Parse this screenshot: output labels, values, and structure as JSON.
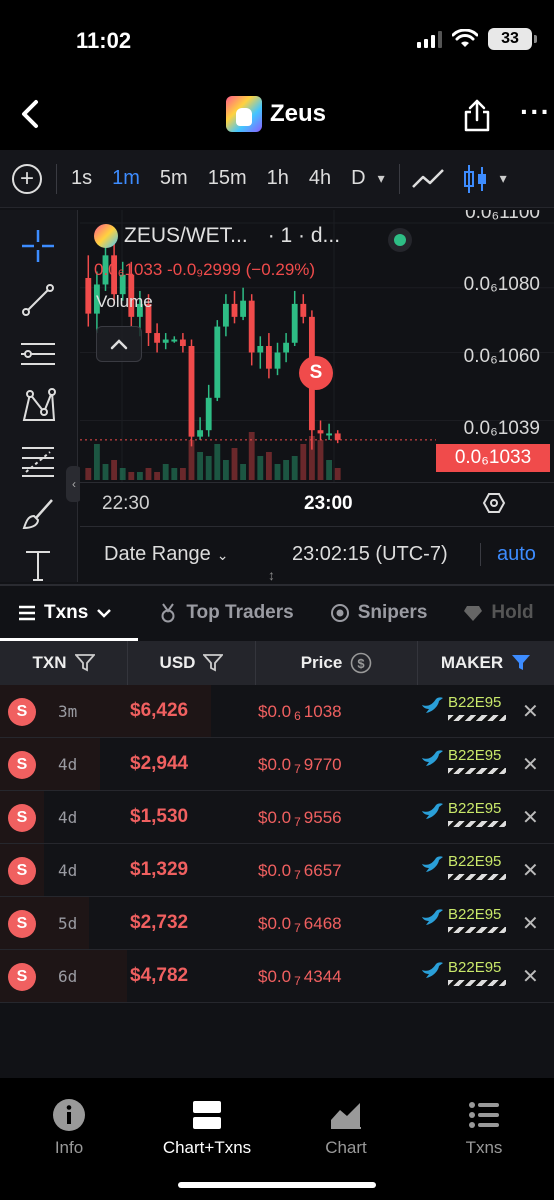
{
  "status": {
    "time": "11:02",
    "battery": "33"
  },
  "header": {
    "title": "Zeus"
  },
  "intervals": [
    "1s",
    "1m",
    "5m",
    "15m",
    "1h",
    "4h",
    "D"
  ],
  "chart_data": {
    "type": "candlestick",
    "legend": {
      "pair": "ZEUS/WET...",
      "interval": "· 1 · d...",
      "ohlc": "0.0₆1033 -0.0₉2999 (−0.29%)",
      "volume_label": "Volume"
    },
    "price_axis": [
      "0.0₆1100",
      "0.0₆1080",
      "0.0₆1060",
      "0.0₆1039"
    ],
    "current_price_tag": "0.0₆1033",
    "time_axis": [
      "22:30",
      "23:00"
    ],
    "marker": "S",
    "candles": [
      {
        "o": 1083,
        "c": 1072,
        "h": 1090,
        "l": 1068
      },
      {
        "o": 1072,
        "c": 1081,
        "h": 1085,
        "l": 1066
      },
      {
        "o": 1081,
        "c": 1090,
        "h": 1098,
        "l": 1079
      },
      {
        "o": 1090,
        "c": 1078,
        "h": 1095,
        "l": 1075
      },
      {
        "o": 1078,
        "c": 1084,
        "h": 1088,
        "l": 1076
      },
      {
        "o": 1084,
        "c": 1071,
        "h": 1088,
        "l": 1068
      },
      {
        "o": 1071,
        "c": 1075,
        "h": 1079,
        "l": 1065
      },
      {
        "o": 1075,
        "c": 1066,
        "h": 1078,
        "l": 1062
      },
      {
        "o": 1066,
        "c": 1063,
        "h": 1069,
        "l": 1060
      },
      {
        "o": 1063,
        "c": 1064,
        "h": 1066,
        "l": 1061
      },
      {
        "o": 1064,
        "c": 1064,
        "h": 1065,
        "l": 1063
      },
      {
        "o": 1064,
        "c": 1062,
        "h": 1066,
        "l": 1060
      },
      {
        "o": 1062,
        "c": 1034,
        "h": 1064,
        "l": 1031
      },
      {
        "o": 1034,
        "c": 1036,
        "h": 1040,
        "l": 1033
      },
      {
        "o": 1036,
        "c": 1046,
        "h": 1050,
        "l": 1034
      },
      {
        "o": 1046,
        "c": 1068,
        "h": 1070,
        "l": 1045
      },
      {
        "o": 1068,
        "c": 1075,
        "h": 1078,
        "l": 1065
      },
      {
        "o": 1075,
        "c": 1071,
        "h": 1079,
        "l": 1069
      },
      {
        "o": 1071,
        "c": 1076,
        "h": 1080,
        "l": 1070
      },
      {
        "o": 1076,
        "c": 1060,
        "h": 1078,
        "l": 1056
      },
      {
        "o": 1060,
        "c": 1062,
        "h": 1065,
        "l": 1055
      },
      {
        "o": 1062,
        "c": 1055,
        "h": 1066,
        "l": 1052
      },
      {
        "o": 1055,
        "c": 1060,
        "h": 1063,
        "l": 1053
      },
      {
        "o": 1060,
        "c": 1063,
        "h": 1066,
        "l": 1057
      },
      {
        "o": 1063,
        "c": 1075,
        "h": 1079,
        "l": 1062
      },
      {
        "o": 1075,
        "c": 1071,
        "h": 1078,
        "l": 1069
      },
      {
        "o": 1071,
        "c": 1036,
        "h": 1073,
        "l": 1030
      },
      {
        "o": 1036,
        "c": 1035,
        "h": 1039,
        "l": 1033
      },
      {
        "o": 1035,
        "c": 1035,
        "h": 1038,
        "l": 1033
      },
      {
        "o": 1035,
        "c": 1033,
        "h": 1036,
        "l": 1032
      }
    ],
    "volumes": [
      3,
      9,
      4,
      5,
      3,
      2,
      2,
      3,
      2,
      4,
      3,
      3,
      10,
      7,
      6,
      9,
      5,
      8,
      4,
      12,
      6,
      7,
      4,
      5,
      6,
      9,
      11,
      10,
      5,
      3
    ]
  },
  "date_bar": {
    "range_label": "Date Range",
    "clock": "23:02:15 (UTC-7)",
    "auto": "auto"
  },
  "tabs": [
    "Txns",
    "Top Traders",
    "Snipers",
    "Hold"
  ],
  "table": {
    "headers": [
      "TXN",
      "USD",
      "Price",
      "MAKER"
    ],
    "rows": [
      {
        "type": "S",
        "age": "3m",
        "usd": "$6,426",
        "price_prefix": "$0.0",
        "price_sub": "6",
        "price_digits": "1038",
        "maker": "B22E95",
        "bar_fraction": 0.38
      },
      {
        "type": "S",
        "age": "4d",
        "usd": "$2,944",
        "price_prefix": "$0.0",
        "price_sub": "7",
        "price_digits": "9770",
        "maker": "B22E95",
        "bar_fraction": 0.18
      },
      {
        "type": "S",
        "age": "4d",
        "usd": "$1,530",
        "price_prefix": "$0.0",
        "price_sub": "7",
        "price_digits": "9556",
        "maker": "B22E95",
        "bar_fraction": 0.08
      },
      {
        "type": "S",
        "age": "4d",
        "usd": "$1,329",
        "price_prefix": "$0.0",
        "price_sub": "7",
        "price_digits": "6657",
        "maker": "B22E95",
        "bar_fraction": 0.08
      },
      {
        "type": "S",
        "age": "5d",
        "usd": "$2,732",
        "price_prefix": "$0.0",
        "price_sub": "7",
        "price_digits": "6468",
        "maker": "B22E95",
        "bar_fraction": 0.16
      },
      {
        "type": "S",
        "age": "6d",
        "usd": "$4,782",
        "price_prefix": "$0.0",
        "price_sub": "7",
        "price_digits": "4344",
        "maker": "B22E95",
        "bar_fraction": 0.23
      }
    ]
  },
  "bottom_nav": [
    "Info",
    "Chart+Txns",
    "Chart",
    "Txns"
  ],
  "colors": {
    "up": "#2ebd85",
    "down": "#f04b4b",
    "accent": "#3d8cff"
  }
}
